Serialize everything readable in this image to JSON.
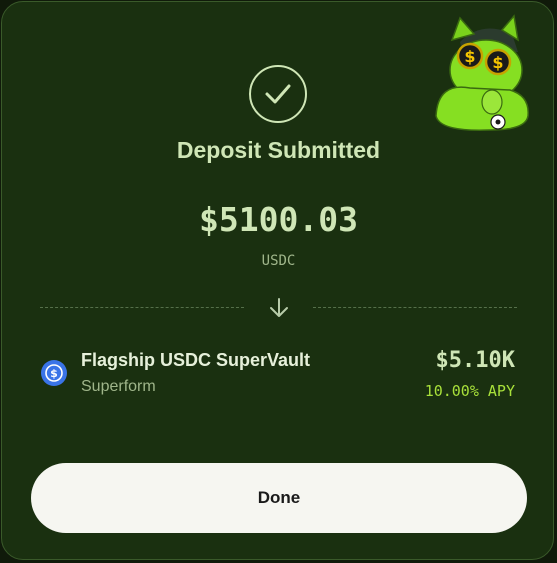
{
  "deposit": {
    "title": "Deposit Submitted",
    "amount": "$5100.03",
    "currency": "USDC"
  },
  "vault": {
    "name": "Flagship USDC SuperVault",
    "provider": "Superform",
    "value": "$5.10K",
    "apy": "10.00% APY",
    "icon": "superform-vault-icon"
  },
  "actions": {
    "done_label": "Done"
  },
  "colors": {
    "background": "#1a3010",
    "accent": "#cfe6b6",
    "apy_green": "#a8e03a",
    "button_bg": "#f6f6f1"
  }
}
